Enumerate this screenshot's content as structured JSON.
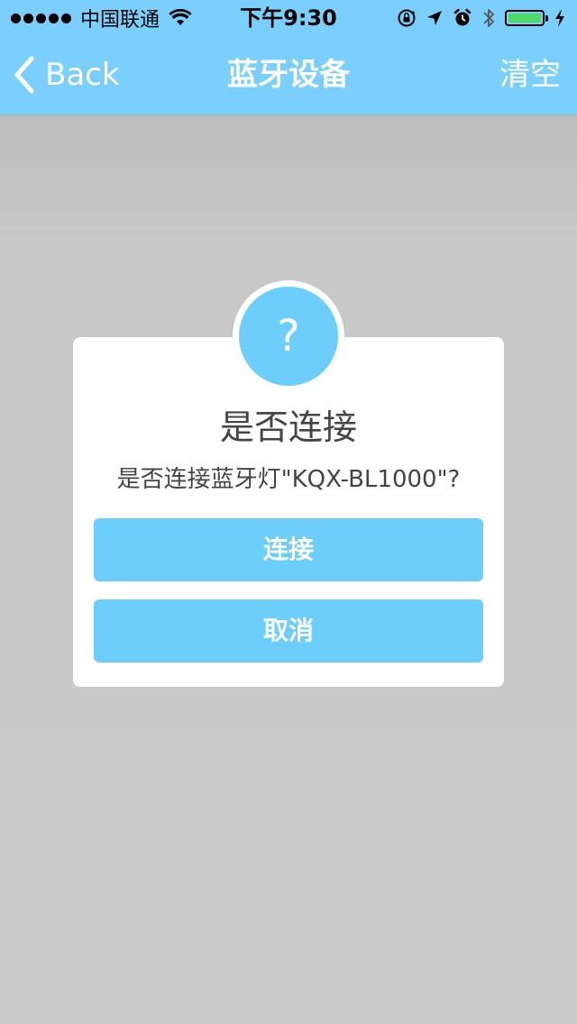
{
  "status_bar": {
    "carrier": "中国联通",
    "time": "下午9:30",
    "icons": [
      "signal-dots-icon",
      "wifi-icon",
      "orientation-lock-icon",
      "location-arrow-icon",
      "alarm-icon",
      "bluetooth-icon",
      "battery-icon",
      "charging-bolt-icon"
    ],
    "battery_color": "#4cd964"
  },
  "nav": {
    "back_label": "Back",
    "title": "蓝牙设备",
    "right_label": "清空",
    "background_color": "#7acffc"
  },
  "dialog": {
    "icon_symbol": "?",
    "title": "是否连接",
    "message": "是否连接蓝牙灯\"KQX-BL1000\"?",
    "confirm_label": "连接",
    "cancel_label": "取消",
    "button_color": "#6dcdfb"
  }
}
